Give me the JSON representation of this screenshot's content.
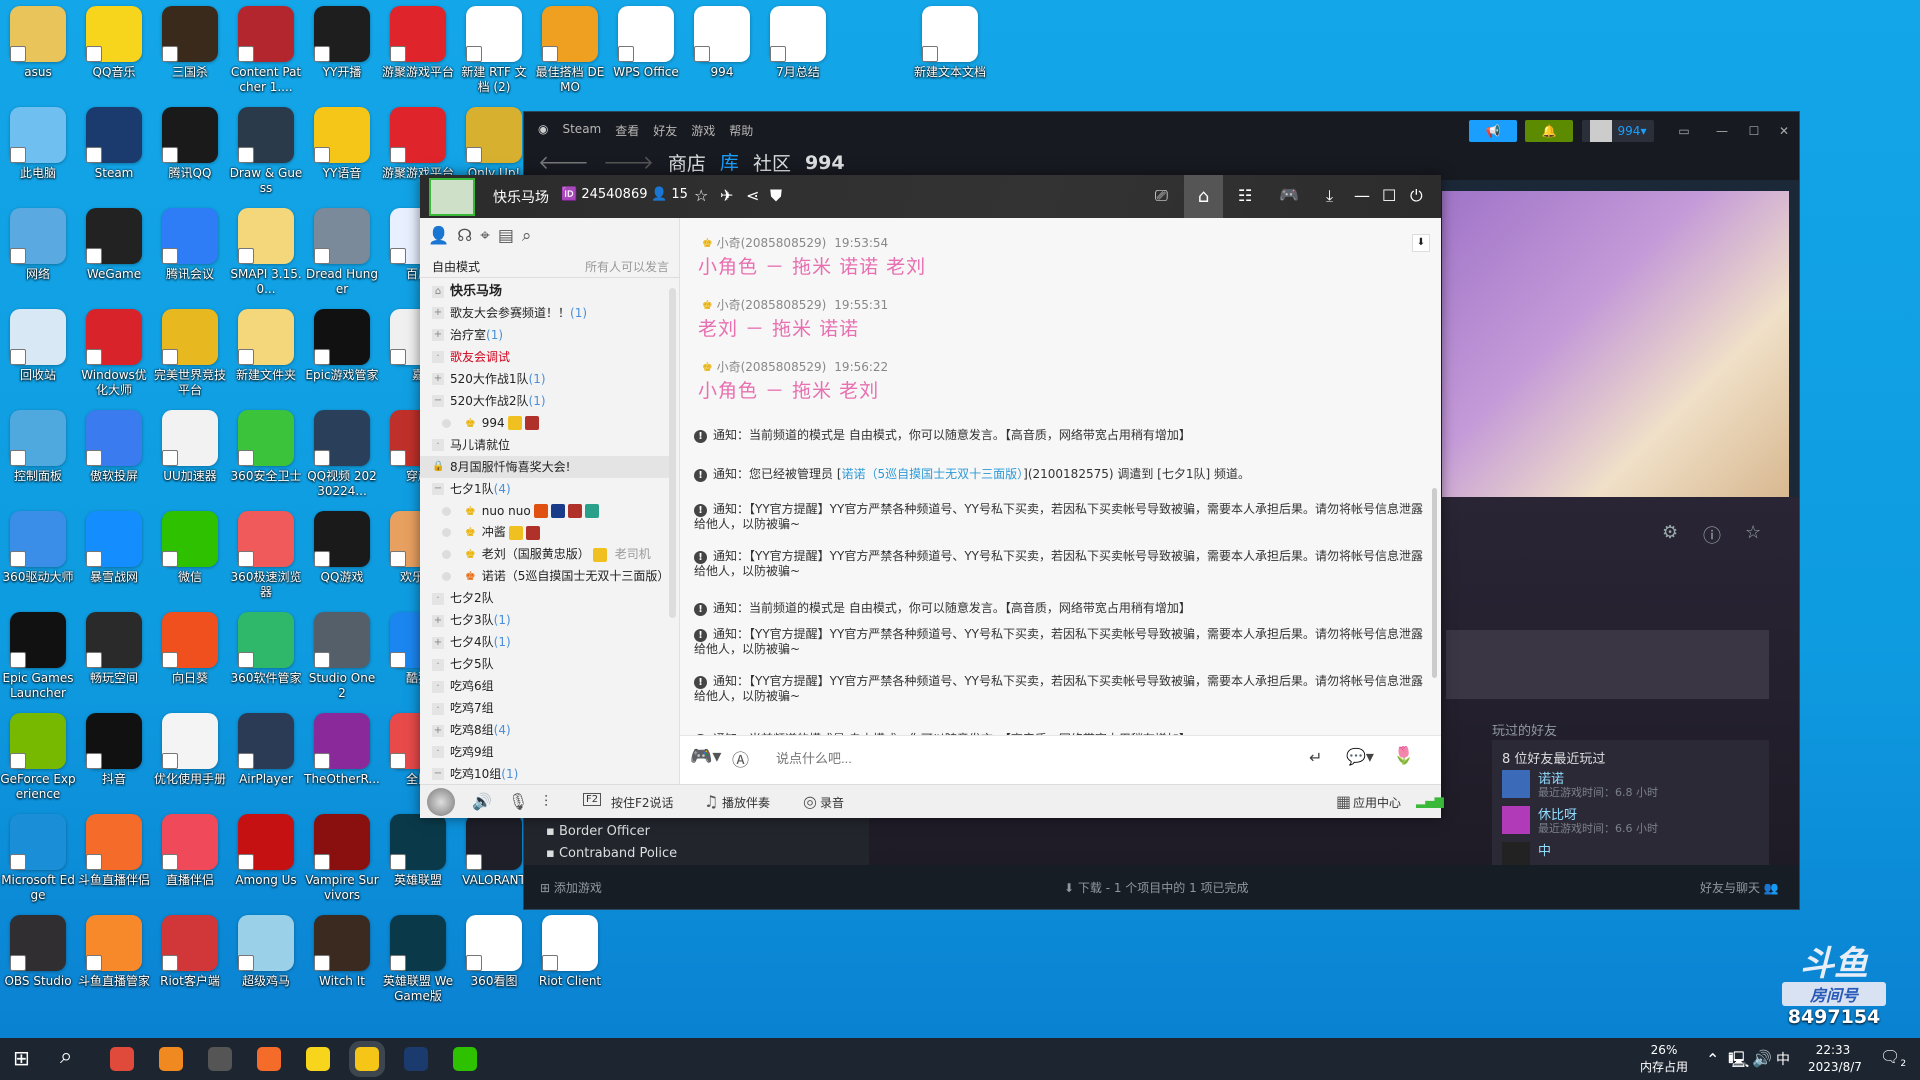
{
  "desktop": {
    "columns": [
      [
        {
          "label": "asus",
          "color": "#e8c45a"
        },
        {
          "label": "此电脑",
          "color": "#6fc0f0"
        },
        {
          "label": "网络",
          "color": "#5aa9e0"
        },
        {
          "label": "回收站",
          "color": "#d8e8f4"
        },
        {
          "label": "控制面板",
          "color": "#4fa8de"
        },
        {
          "label": "360驱动大师",
          "color": "#3b8ee8"
        },
        {
          "label": "Epic Games Launcher",
          "color": "#111111"
        },
        {
          "label": "GeForce Experience",
          "color": "#76b900"
        },
        {
          "label": "Microsoft Edge",
          "color": "#1a8fd8"
        },
        {
          "label": "OBS Studio",
          "color": "#302e31"
        }
      ],
      [
        {
          "label": "QQ音乐",
          "color": "#f7d51d"
        },
        {
          "label": "Steam",
          "color": "#1b3b6f"
        },
        {
          "label": "WeGame",
          "color": "#222222"
        },
        {
          "label": "Windows优化大师",
          "color": "#d8232a"
        },
        {
          "label": "傲软投屏",
          "color": "#3a7bf0"
        },
        {
          "label": "暴雪战网",
          "color": "#148eff"
        },
        {
          "label": "畅玩空间",
          "color": "#2a2a2a"
        },
        {
          "label": "抖音",
          "color": "#111111"
        },
        {
          "label": "斗鱼直播伴侣",
          "color": "#f46b2a"
        },
        {
          "label": "斗鱼直播管家",
          "color": "#f7892b"
        }
      ],
      [
        {
          "label": "三国杀",
          "color": "#3a2a1c"
        },
        {
          "label": "腾讯QQ",
          "color": "#1a1a1a"
        },
        {
          "label": "腾讯会议",
          "color": "#2e7cf6"
        },
        {
          "label": "完美世界竞技平台",
          "color": "#e8b820"
        },
        {
          "label": "UU加速器",
          "color": "#f2f2f2"
        },
        {
          "label": "微信",
          "color": "#2dc100"
        },
        {
          "label": "向日葵",
          "color": "#f0501e"
        },
        {
          "label": "优化使用手册",
          "color": "#f4f4f4"
        },
        {
          "label": "直播伴侣",
          "color": "#f04a5a"
        },
        {
          "label": "Riot客户端",
          "color": "#d13639"
        }
      ],
      [
        {
          "label": "Content Patcher 1....",
          "color": "#b3262d"
        },
        {
          "label": "Draw & Guess",
          "color": "#2a3a4a"
        },
        {
          "label": "SMAPI 3.15.0...",
          "color": "#f3d77a"
        },
        {
          "label": "新建文件夹",
          "color": "#f3d77a"
        },
        {
          "label": "360安全卫士",
          "color": "#3cc33c"
        },
        {
          "label": "360极速浏览器",
          "color": "#f05a5a"
        },
        {
          "label": "360软件管家",
          "color": "#2fb86a"
        },
        {
          "label": "AirPlayer",
          "color": "#2b3a55"
        },
        {
          "label": "Among Us",
          "color": "#c51111"
        },
        {
          "label": "超级鸡马",
          "color": "#9ad0e8"
        }
      ],
      [
        {
          "label": "YY开播",
          "color": "#1e1e1e"
        },
        {
          "label": "YY语音",
          "color": "#f5c518"
        },
        {
          "label": "Dread Hunger",
          "color": "#7a8a9a"
        },
        {
          "label": "Epic游戏管家",
          "color": "#111111"
        },
        {
          "label": "QQ视频 20230224...",
          "color": "#2a3f5a"
        },
        {
          "label": "QQ游戏",
          "color": "#1a1a1a"
        },
        {
          "label": "Studio One 2",
          "color": "#555f6a"
        },
        {
          "label": "TheOtherR...",
          "color": "#8a2a9a"
        },
        {
          "label": "Vampire Survivors",
          "color": "#8a1010"
        },
        {
          "label": "Witch It",
          "color": "#3a2a20"
        }
      ],
      [
        {
          "label": "游聚游戏平台",
          "color": "#e0242c"
        },
        {
          "label": "游聚游戏平台",
          "color": "#e0242c"
        },
        {
          "label": "百度",
          "color": "#e8f0ff"
        },
        {
          "label": "嘉",
          "color": "#f0f0f0"
        },
        {
          "label": "穿越",
          "color": "#c0302a"
        },
        {
          "label": "欢乐斗",
          "color": "#e8a060"
        },
        {
          "label": "酷狗",
          "color": "#1b86f0"
        },
        {
          "label": "全民",
          "color": "#e84a4a"
        },
        {
          "label": "英雄联盟",
          "color": "#0a3a4a"
        },
        {
          "label": "英雄联盟 WeGame版",
          "color": "#0a3a4a"
        }
      ],
      [
        {
          "label": "新建 RTF 文档 (2)",
          "color": "#ffffff"
        },
        {
          "label": "Only Up!",
          "color": "#d8b030"
        },
        null,
        null,
        null,
        null,
        null,
        null,
        {
          "label": "VALORANT",
          "color": "#1f1f2a"
        },
        {
          "label": "360看图",
          "color": "#ffffff"
        }
      ],
      [
        {
          "label": "最佳搭档 DEMO",
          "color": "#f0a020"
        },
        null,
        null,
        null,
        null,
        null,
        null,
        null,
        null,
        {
          "label": "Riot Client",
          "color": "#ffffff"
        }
      ],
      [
        {
          "label": "WPS Office",
          "color": "#ffffff"
        }
      ],
      [
        {
          "label": "994",
          "color": "#ffffff"
        }
      ],
      [
        {
          "label": "7月总结",
          "color": "#ffffff"
        }
      ],
      null,
      [
        {
          "label": "新建文本文档",
          "color": "#ffffff"
        }
      ]
    ]
  },
  "steam": {
    "menu": [
      "Steam",
      "查看",
      "好友",
      "游戏",
      "帮助"
    ],
    "nav": [
      "商店",
      "库",
      "社区",
      "994"
    ],
    "nav_active": "库",
    "user": "994",
    "games": [
      "Border Officer",
      "Contraband Police"
    ],
    "friends_title": "玩过的好友",
    "friends_recent": "8 位好友最近玩过",
    "friends": [
      {
        "name": "诺诺",
        "playtime": "最近游戏时间：6.8 小时",
        "color": "#3a6ab8"
      },
      {
        "name": "休比呀",
        "playtime": "最近游戏时间：6.6 小时",
        "color": "#b03ab8"
      },
      {
        "name": "中",
        "playtime": "",
        "color": "#222222"
      }
    ],
    "add_game": "添加游戏",
    "download": "下载 - 1 个项目中的 1 项已完成",
    "friends_chat": "好友与聊天",
    "colors": {
      "accent": "#1a9fff",
      "bell": "#5c8a00"
    }
  },
  "yy": {
    "channel_name": "快乐马场",
    "channel_id": "24540869",
    "online": "15",
    "mode": "自由模式",
    "mode_desc": "所有人可以发言",
    "tree": [
      {
        "label": "快乐马场",
        "type": "root"
      },
      {
        "label": "歌友大会参赛频道！！",
        "count": "(1)",
        "exp": "+"
      },
      {
        "label": "治疗室",
        "count": "(1)",
        "exp": "+"
      },
      {
        "label": "歌友会调试",
        "exp": "·",
        "red": true
      },
      {
        "label": "520大作战1队",
        "count": "(1)",
        "exp": "+"
      },
      {
        "label": "520大作战2队",
        "count": "(1)",
        "exp": "−"
      },
      {
        "label": "994",
        "type": "user",
        "badges": [
          "#f0c020",
          "#b0302a"
        ]
      },
      {
        "label": "马儿请就位",
        "exp": "·"
      },
      {
        "label": "8月国服忏悔喜奖大会!",
        "exp": "🔒",
        "selected": true
      },
      {
        "label": "七夕1队",
        "count": "(4)",
        "exp": "−"
      },
      {
        "label": "nuo nuo",
        "type": "user",
        "badges": [
          "#e05010",
          "#1a3a8a",
          "#b0302a",
          "#2aa08a"
        ]
      },
      {
        "label": "冲酱",
        "type": "user",
        "badges": [
          "#f0c020",
          "#b0302a"
        ]
      },
      {
        "label": "老刘（国服黄忠版）",
        "type": "user",
        "badges": [
          "#f0c020"
        ],
        "tag": "老司机"
      },
      {
        "label": "诺诺（5巡自摸国士无双十三面版）",
        "type": "user",
        "orange": true
      },
      {
        "label": "七夕2队",
        "exp": "·"
      },
      {
        "label": "七夕3队",
        "count": "(1)",
        "exp": "+"
      },
      {
        "label": "七夕4队",
        "count": "(1)",
        "exp": "+"
      },
      {
        "label": "七夕5队",
        "exp": "·"
      },
      {
        "label": "吃鸡6组",
        "exp": "·"
      },
      {
        "label": "吃鸡7组",
        "exp": "·"
      },
      {
        "label": "吃鸡8组",
        "count": "(4)",
        "exp": "+"
      },
      {
        "label": "吃鸡9组",
        "exp": "·"
      },
      {
        "label": "吃鸡10组",
        "count": "(1)",
        "exp": "−"
      }
    ],
    "messages": [
      {
        "sender": "小奇(2085808529)",
        "time": "19:53:54",
        "text": "小角色 － 拖米  诺诺  老刘"
      },
      {
        "sender": "小奇(2085808529)",
        "time": "19:55:31",
        "text": "老刘 － 拖米  诺诺"
      },
      {
        "sender": "小奇(2085808529)",
        "time": "19:56:22",
        "text": "小角色 － 拖米    老刘"
      }
    ],
    "notices": [
      {
        "text": "通知：当前频道的模式是 自由模式，你可以随意发言。【高音质，网络带宽占用稍有增加】"
      },
      {
        "pre": "通知：您已经被管理员 [",
        "link": "诺诺（5巡自摸国士无双十三面版）",
        "post": "](2100182575) 调遣到 [七夕1队] 频道。"
      },
      {
        "text": "通知：【YY官方提醒】YY官方严禁各种频道号、YY号私下买卖，若因私下买卖帐号导致被骗，需要本人承担后果。请勿将帐号信息泄露给他人，以防被骗~"
      },
      {
        "text": "通知：【YY官方提醒】YY官方严禁各种频道号、YY号私下买卖，若因私下买卖帐号导致被骗，需要本人承担后果。请勿将帐号信息泄露给他人，以防被骗~"
      },
      {
        "text": "通知：当前频道的模式是 自由模式，你可以随意发言。【高音质，网络带宽占用稍有增加】"
      },
      {
        "text": "通知：【YY官方提醒】YY官方严禁各种频道号、YY号私下买卖，若因私下买卖帐号导致被骗，需要本人承担后果。请勿将帐号信息泄露给他人，以防被骗~"
      },
      {
        "text": "通知：【YY官方提醒】YY官方严禁各种频道号、YY号私下买卖，若因私下买卖帐号导致被骗，需要本人承担后果。请勿将帐号信息泄露给他人，以防被骗~"
      },
      {
        "text": "通知：当前频道的模式是 自由模式，你可以随意发言。【高音质，网络带宽占用稍有增加】"
      }
    ],
    "input_placeholder": "说点什么吧...",
    "toolbar": {
      "f2_key": "F2",
      "ptt": "按住F2说话",
      "accompany": "播放伴奏",
      "record": "录音",
      "app_center": "应用中心"
    },
    "colors": {
      "message": "#e86fb0",
      "link": "#2e9ad6",
      "channel_alert": "#d0021b"
    }
  },
  "watermark": {
    "brand": "斗鱼",
    "room_label": "房间号",
    "room_id": "8497154"
  },
  "taskbar": {
    "memory_pct": "26%",
    "memory_label": "内存占用",
    "ime": "中",
    "time": "22:33",
    "date": "2023/8/7",
    "notifications": "2",
    "apps": [
      {
        "name": "chrome",
        "color": "#e04a3a"
      },
      {
        "name": "firefox",
        "color": "#f08a20"
      },
      {
        "name": "draw-guess",
        "color": "#555"
      },
      {
        "name": "douyu",
        "color": "#f46b2a"
      },
      {
        "name": "qqmusic",
        "color": "#f7d51d"
      },
      {
        "name": "yy",
        "color": "#f5c518"
      },
      {
        "name": "steam",
        "color": "#1b3b6f"
      },
      {
        "name": "wechat",
        "color": "#2dc100"
      }
    ]
  }
}
